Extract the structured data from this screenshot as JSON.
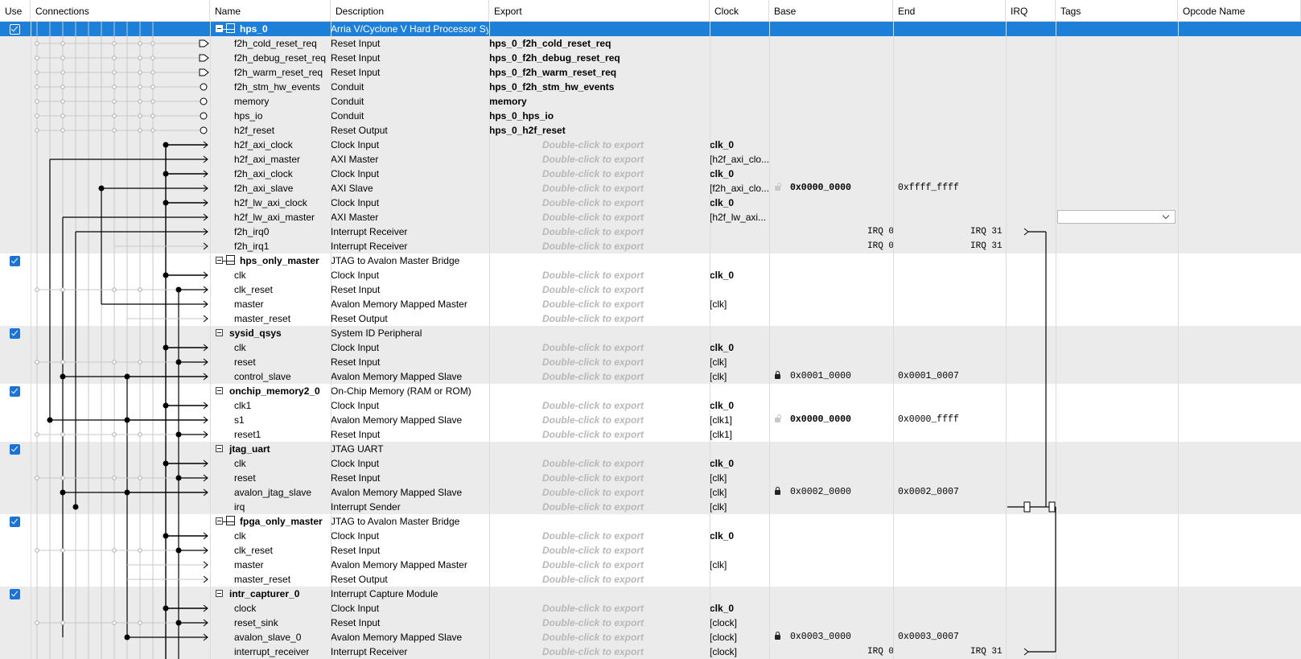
{
  "columns": [
    "Use",
    "Connections",
    "Name",
    "Description",
    "Export",
    "Clock",
    "Base",
    "End",
    "IRQ",
    "Tags",
    "Opcode Name"
  ],
  "export_placeholder": "Double-click to export",
  "rows": [
    {
      "type": "comp",
      "use": true,
      "selected": true,
      "icon": "subsystem-icon",
      "name": "hps_0",
      "desc": "Arria V/Cyclone V Hard Processor System"
    },
    {
      "type": "if",
      "name": "f2h_cold_reset_req",
      "desc": "Reset Input",
      "export": "hps_0_f2h_cold_reset_req"
    },
    {
      "type": "if",
      "name": "f2h_debug_reset_req",
      "desc": "Reset Input",
      "export": "hps_0_f2h_debug_reset_req"
    },
    {
      "type": "if",
      "name": "f2h_warm_reset_req",
      "desc": "Reset Input",
      "export": "hps_0_f2h_warm_reset_req"
    },
    {
      "type": "if",
      "name": "f2h_stm_hw_events",
      "desc": "Conduit",
      "export": "hps_0_f2h_stm_hw_events"
    },
    {
      "type": "if",
      "name": "memory",
      "desc": "Conduit",
      "export": "memory"
    },
    {
      "type": "if",
      "name": "hps_io",
      "desc": "Conduit",
      "export": "hps_0_hps_io"
    },
    {
      "type": "if",
      "name": "h2f_reset",
      "desc": "Reset Output",
      "export": "hps_0_h2f_reset"
    },
    {
      "type": "if",
      "name": "h2f_axi_clock",
      "desc": "Clock Input",
      "clock": "clk_0",
      "clock_bold": true
    },
    {
      "type": "if",
      "name": "h2f_axi_master",
      "desc": "AXI Master",
      "clock": "[h2f_axi_clo..."
    },
    {
      "type": "if",
      "name": "f2h_axi_clock",
      "desc": "Clock Input",
      "clock": "clk_0",
      "clock_bold": true
    },
    {
      "type": "if",
      "name": "f2h_axi_slave",
      "desc": "AXI Slave",
      "clock": "[f2h_axi_clo...",
      "lock": "open",
      "base": "0x0000_0000",
      "base_bold": true,
      "end": "0xffff_ffff"
    },
    {
      "type": "if",
      "name": "h2f_lw_axi_clock",
      "desc": "Clock Input",
      "clock": "clk_0",
      "clock_bold": true
    },
    {
      "type": "if",
      "name": "h2f_lw_axi_master",
      "desc": "AXI Master",
      "clock": "[h2f_lw_axi...",
      "combo": true
    },
    {
      "type": "if",
      "name": "f2h_irq0",
      "desc": "Interrupt Receiver",
      "irq_lo": "IRQ 0",
      "irq_hi": "IRQ 31"
    },
    {
      "type": "if",
      "name": "f2h_irq1",
      "desc": "Interrupt Receiver",
      "irq_lo": "IRQ 0",
      "irq_hi": "IRQ 31"
    },
    {
      "type": "comp",
      "use": true,
      "icon": "subsystem-icon",
      "name": "hps_only_master",
      "desc": "JTAG to Avalon Master Bridge"
    },
    {
      "type": "if",
      "name": "clk",
      "desc": "Clock Input",
      "clock": "clk_0",
      "clock_bold": true
    },
    {
      "type": "if",
      "name": "clk_reset",
      "desc": "Reset Input"
    },
    {
      "type": "if",
      "name": "master",
      "desc": "Avalon Memory Mapped Master",
      "clock": "[clk]"
    },
    {
      "type": "if",
      "name": "master_reset",
      "desc": "Reset Output"
    },
    {
      "type": "comp",
      "use": true,
      "name": "sysid_qsys",
      "desc": "System ID Peripheral"
    },
    {
      "type": "if",
      "name": "clk",
      "desc": "Clock Input",
      "clock": "clk_0",
      "clock_bold": true
    },
    {
      "type": "if",
      "name": "reset",
      "desc": "Reset Input",
      "clock": "[clk]"
    },
    {
      "type": "if",
      "name": "control_slave",
      "desc": "Avalon Memory Mapped Slave",
      "clock": "[clk]",
      "lock": "closed",
      "base": "0x0001_0000",
      "end": "0x0001_0007"
    },
    {
      "type": "comp",
      "use": true,
      "name": "onchip_memory2_0",
      "desc": "On-Chip Memory (RAM or ROM)"
    },
    {
      "type": "if",
      "name": "clk1",
      "desc": "Clock Input",
      "clock": "clk_0",
      "clock_bold": true
    },
    {
      "type": "if",
      "name": "s1",
      "desc": "Avalon Memory Mapped Slave",
      "clock": "[clk1]",
      "lock": "open",
      "base": "0x0000_0000",
      "base_bold": true,
      "end": "0x0000_ffff"
    },
    {
      "type": "if",
      "name": "reset1",
      "desc": "Reset Input",
      "clock": "[clk1]"
    },
    {
      "type": "comp",
      "use": true,
      "name": "jtag_uart",
      "desc": "JTAG UART"
    },
    {
      "type": "if",
      "name": "clk",
      "desc": "Clock Input",
      "clock": "clk_0",
      "clock_bold": true
    },
    {
      "type": "if",
      "name": "reset",
      "desc": "Reset Input",
      "clock": "[clk]"
    },
    {
      "type": "if",
      "name": "avalon_jtag_slave",
      "desc": "Avalon Memory Mapped Slave",
      "clock": "[clk]",
      "lock": "closed",
      "base": "0x0002_0000",
      "end": "0x0002_0007"
    },
    {
      "type": "if",
      "name": "irq",
      "desc": "Interrupt Sender",
      "clock": "[clk]",
      "irq_sender": true
    },
    {
      "type": "comp",
      "use": true,
      "icon": "subsystem-icon",
      "name": "fpga_only_master",
      "desc": "JTAG to Avalon Master Bridge"
    },
    {
      "type": "if",
      "name": "clk",
      "desc": "Clock Input",
      "clock": "clk_0",
      "clock_bold": true
    },
    {
      "type": "if",
      "name": "clk_reset",
      "desc": "Reset Input"
    },
    {
      "type": "if",
      "name": "master",
      "desc": "Avalon Memory Mapped Master",
      "clock": "[clk]"
    },
    {
      "type": "if",
      "name": "master_reset",
      "desc": "Reset Output"
    },
    {
      "type": "comp",
      "use": true,
      "name": "intr_capturer_0",
      "desc": "Interrupt Capture Module"
    },
    {
      "type": "if",
      "name": "clock",
      "desc": "Clock Input",
      "clock": "clk_0",
      "clock_bold": true
    },
    {
      "type": "if",
      "name": "reset_sink",
      "desc": "Reset Input",
      "clock": "[clock]"
    },
    {
      "type": "if",
      "name": "avalon_slave_0",
      "desc": "Avalon Memory Mapped Slave",
      "clock": "[clock]",
      "lock": "closed",
      "base": "0x0003_0000",
      "end": "0x0003_0007"
    },
    {
      "type": "if",
      "name": "interrupt_receiver",
      "desc": "Interrupt Receiver",
      "clock": "[clock]",
      "irq_lo": "IRQ 0",
      "irq_hi": "IRQ 31"
    }
  ]
}
